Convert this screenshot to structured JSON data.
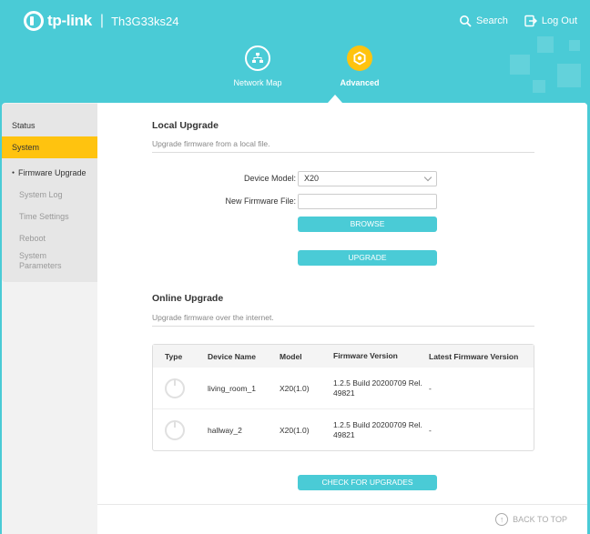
{
  "header": {
    "brand": "tp-link",
    "model": "Th3G33ks24",
    "search_label": "Search",
    "logout_label": "Log Out"
  },
  "nav": {
    "items": [
      {
        "label": "Network Map",
        "icon": "network-map-icon",
        "active": false
      },
      {
        "label": "Advanced",
        "icon": "advanced-gear-icon",
        "active": true
      }
    ]
  },
  "sidebar": {
    "items": [
      {
        "label": "Status"
      },
      {
        "label": "System",
        "active": true
      }
    ],
    "sub_items": [
      {
        "label": "Firmware Upgrade",
        "active": true
      },
      {
        "label": "System Log"
      },
      {
        "label": "Time Settings"
      },
      {
        "label": "Reboot"
      },
      {
        "label": "System Parameters"
      }
    ]
  },
  "local_upgrade": {
    "title": "Local Upgrade",
    "description": "Upgrade firmware from a local file.",
    "device_model_label": "Device Model:",
    "device_model_value": "X20",
    "firmware_file_label": "New Firmware File:",
    "firmware_file_value": "",
    "browse_label": "BROWSE",
    "upgrade_label": "UPGRADE"
  },
  "online_upgrade": {
    "title": "Online Upgrade",
    "description": "Upgrade firmware over the internet.",
    "columns": [
      "Type",
      "Device Name",
      "Model",
      "Firmware Version",
      "Latest Firmware Version"
    ],
    "rows": [
      {
        "device_name": "living_room_1",
        "model": "X20(1.0)",
        "firmware": "1.2.5 Build 20200709 Rel. 49821",
        "latest": "-"
      },
      {
        "device_name": "hallway_2",
        "model": "X20(1.0)",
        "firmware": "1.2.5 Build 20200709 Rel. 49821",
        "latest": "-"
      }
    ],
    "check_label": "CHECK FOR UPGRADES"
  },
  "footer": {
    "back_to_top": "BACK TO TOP"
  },
  "colors": {
    "brand_teal": "#4acbd6",
    "accent_yellow": "#ffc30f"
  }
}
